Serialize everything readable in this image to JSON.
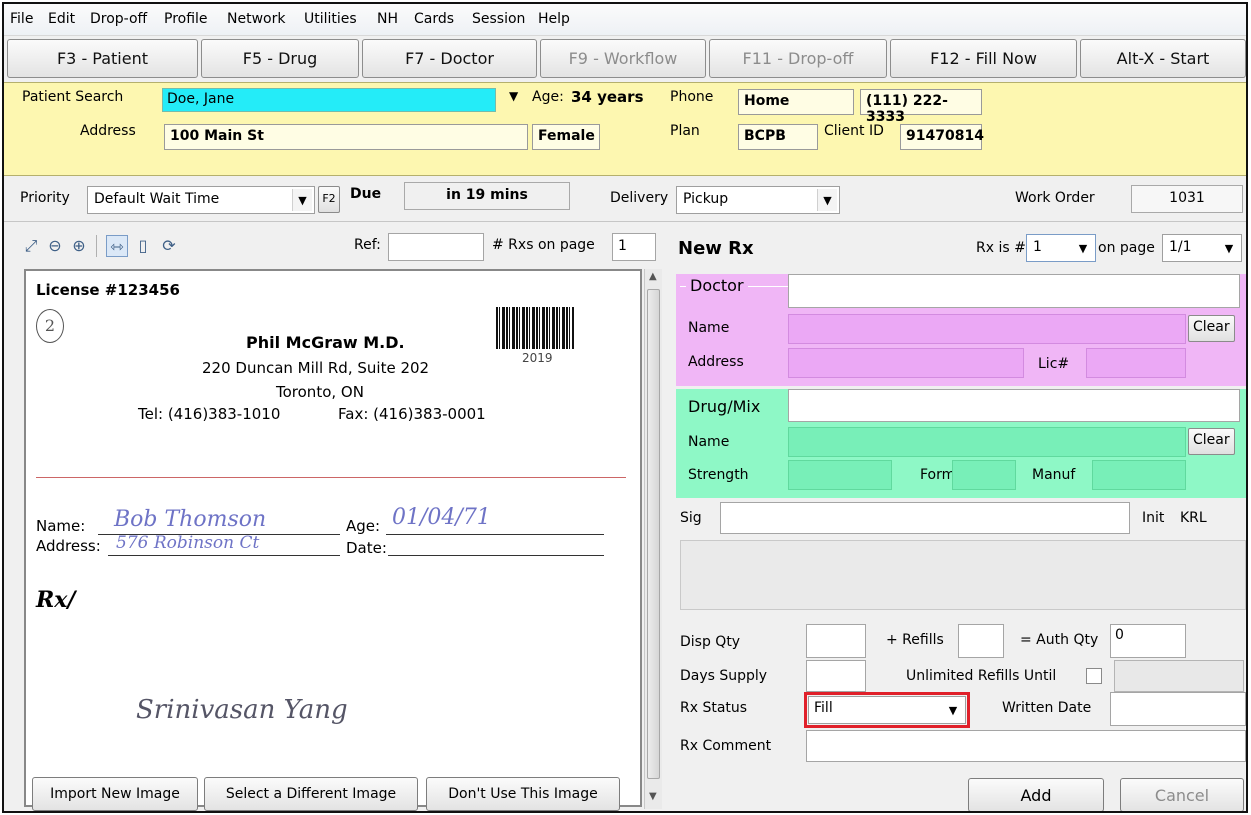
{
  "menu": [
    "File",
    "Edit",
    "Drop-off",
    "Profile",
    "Network",
    "Utilities",
    "NH",
    "Cards",
    "Session",
    "Help"
  ],
  "toolbar": {
    "patient": "F3 - Patient",
    "drug": "F5 - Drug",
    "doctor": "F7 - Doctor",
    "workflow": "F9 - Workflow",
    "dropoff": "F11 - Drop-off",
    "fillnow": "F12 - Fill Now",
    "start": "Alt-X - Start"
  },
  "patient": {
    "search_label": "Patient Search",
    "search_value": "Doe, Jane",
    "age_label": "Age:",
    "age_value": "34 years",
    "phone_label": "Phone",
    "phone_type": "Home",
    "phone_number": "(111) 222-3333",
    "address_label": "Address",
    "address_value": "100 Main St",
    "gender": "Female",
    "plan_label": "Plan",
    "plan_value": "BCPB",
    "client_label": "Client ID",
    "client_value": "91470814"
  },
  "priority": {
    "label": "Priority",
    "value": "Default Wait Time",
    "f2": "F2",
    "due_label": "Due",
    "due_value": "in 19 mins",
    "delivery_label": "Delivery",
    "delivery_value": "Pickup",
    "workorder_label": "Work Order",
    "workorder_value": "1031"
  },
  "image_panel": {
    "ref_label": "Ref:",
    "rxs_label": "# Rxs on page",
    "rxs_value": "1",
    "import_button": "Import New Image",
    "select_button": "Select a Different Image",
    "dont_use_button": "Don't Use This Image"
  },
  "prescription": {
    "license": "License #123456",
    "circled": "2",
    "doctor_name": "Phil McGraw M.D.",
    "address1": "220 Duncan Mill Rd, Suite 202",
    "city": "Toronto, ON",
    "tel": "Tel: (416)383-1010",
    "fax": "Fax: (416)383-0001",
    "barcode_year": "2019",
    "name_label": "Name:",
    "name_value": "Bob Thomson",
    "age_label": "Age:",
    "age_value": "01/04/71",
    "address_label": "Address:",
    "address_value": "576 Robinson Ct",
    "date_label": "Date:",
    "rx_symbol": "Rx/",
    "signature": "Srinivasan Yang"
  },
  "rx": {
    "title": "New Rx",
    "rx_is_label": "Rx is #",
    "rx_is_value": "1",
    "on_page_label": "on page",
    "on_page_value": "1/1",
    "doctor_section": "Doctor",
    "name_label": "Name",
    "address_label": "Address",
    "lic_label": "Lic#",
    "clear": "Clear",
    "drug_section": "Drug/Mix",
    "strength_label": "Strength",
    "form_label": "Form",
    "manuf_label": "Manuf",
    "sig_label": "Sig",
    "init_label": "Init",
    "init_value": "KRL",
    "disp_qty_label": "Disp Qty",
    "refills_label": "+ Refills",
    "auth_qty_label": "= Auth Qty",
    "auth_qty_value": "0",
    "days_supply_label": "Days Supply",
    "unlimited_label": "Unlimited Refills Until",
    "status_label": "Rx Status",
    "status_value": "Fill",
    "written_label": "Written Date",
    "comment_label": "Rx Comment",
    "add_button": "Add",
    "cancel_button": "Cancel"
  },
  "colors": {
    "patient_bg": "#fdf7b0",
    "doctor_bg": "#f0b6f6",
    "drug_bg": "#8ef8c6",
    "highlight_red": "#e0202a",
    "search_cyan": "#24ecf8"
  }
}
